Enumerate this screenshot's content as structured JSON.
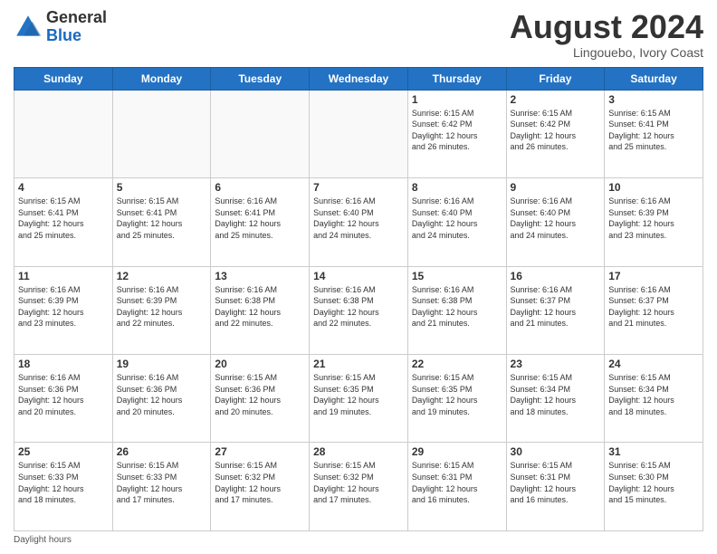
{
  "header": {
    "logo_general": "General",
    "logo_blue": "Blue",
    "month": "August 2024",
    "location": "Lingouebo, Ivory Coast"
  },
  "weekdays": [
    "Sunday",
    "Monday",
    "Tuesday",
    "Wednesday",
    "Thursday",
    "Friday",
    "Saturday"
  ],
  "weeks": [
    [
      {
        "day": "",
        "info": ""
      },
      {
        "day": "",
        "info": ""
      },
      {
        "day": "",
        "info": ""
      },
      {
        "day": "",
        "info": ""
      },
      {
        "day": "1",
        "info": "Sunrise: 6:15 AM\nSunset: 6:42 PM\nDaylight: 12 hours\nand 26 minutes."
      },
      {
        "day": "2",
        "info": "Sunrise: 6:15 AM\nSunset: 6:42 PM\nDaylight: 12 hours\nand 26 minutes."
      },
      {
        "day": "3",
        "info": "Sunrise: 6:15 AM\nSunset: 6:41 PM\nDaylight: 12 hours\nand 25 minutes."
      }
    ],
    [
      {
        "day": "4",
        "info": "Sunrise: 6:15 AM\nSunset: 6:41 PM\nDaylight: 12 hours\nand 25 minutes."
      },
      {
        "day": "5",
        "info": "Sunrise: 6:15 AM\nSunset: 6:41 PM\nDaylight: 12 hours\nand 25 minutes."
      },
      {
        "day": "6",
        "info": "Sunrise: 6:16 AM\nSunset: 6:41 PM\nDaylight: 12 hours\nand 25 minutes."
      },
      {
        "day": "7",
        "info": "Sunrise: 6:16 AM\nSunset: 6:40 PM\nDaylight: 12 hours\nand 24 minutes."
      },
      {
        "day": "8",
        "info": "Sunrise: 6:16 AM\nSunset: 6:40 PM\nDaylight: 12 hours\nand 24 minutes."
      },
      {
        "day": "9",
        "info": "Sunrise: 6:16 AM\nSunset: 6:40 PM\nDaylight: 12 hours\nand 24 minutes."
      },
      {
        "day": "10",
        "info": "Sunrise: 6:16 AM\nSunset: 6:39 PM\nDaylight: 12 hours\nand 23 minutes."
      }
    ],
    [
      {
        "day": "11",
        "info": "Sunrise: 6:16 AM\nSunset: 6:39 PM\nDaylight: 12 hours\nand 23 minutes."
      },
      {
        "day": "12",
        "info": "Sunrise: 6:16 AM\nSunset: 6:39 PM\nDaylight: 12 hours\nand 22 minutes."
      },
      {
        "day": "13",
        "info": "Sunrise: 6:16 AM\nSunset: 6:38 PM\nDaylight: 12 hours\nand 22 minutes."
      },
      {
        "day": "14",
        "info": "Sunrise: 6:16 AM\nSunset: 6:38 PM\nDaylight: 12 hours\nand 22 minutes."
      },
      {
        "day": "15",
        "info": "Sunrise: 6:16 AM\nSunset: 6:38 PM\nDaylight: 12 hours\nand 21 minutes."
      },
      {
        "day": "16",
        "info": "Sunrise: 6:16 AM\nSunset: 6:37 PM\nDaylight: 12 hours\nand 21 minutes."
      },
      {
        "day": "17",
        "info": "Sunrise: 6:16 AM\nSunset: 6:37 PM\nDaylight: 12 hours\nand 21 minutes."
      }
    ],
    [
      {
        "day": "18",
        "info": "Sunrise: 6:16 AM\nSunset: 6:36 PM\nDaylight: 12 hours\nand 20 minutes."
      },
      {
        "day": "19",
        "info": "Sunrise: 6:16 AM\nSunset: 6:36 PM\nDaylight: 12 hours\nand 20 minutes."
      },
      {
        "day": "20",
        "info": "Sunrise: 6:15 AM\nSunset: 6:36 PM\nDaylight: 12 hours\nand 20 minutes."
      },
      {
        "day": "21",
        "info": "Sunrise: 6:15 AM\nSunset: 6:35 PM\nDaylight: 12 hours\nand 19 minutes."
      },
      {
        "day": "22",
        "info": "Sunrise: 6:15 AM\nSunset: 6:35 PM\nDaylight: 12 hours\nand 19 minutes."
      },
      {
        "day": "23",
        "info": "Sunrise: 6:15 AM\nSunset: 6:34 PM\nDaylight: 12 hours\nand 18 minutes."
      },
      {
        "day": "24",
        "info": "Sunrise: 6:15 AM\nSunset: 6:34 PM\nDaylight: 12 hours\nand 18 minutes."
      }
    ],
    [
      {
        "day": "25",
        "info": "Sunrise: 6:15 AM\nSunset: 6:33 PM\nDaylight: 12 hours\nand 18 minutes."
      },
      {
        "day": "26",
        "info": "Sunrise: 6:15 AM\nSunset: 6:33 PM\nDaylight: 12 hours\nand 17 minutes."
      },
      {
        "day": "27",
        "info": "Sunrise: 6:15 AM\nSunset: 6:32 PM\nDaylight: 12 hours\nand 17 minutes."
      },
      {
        "day": "28",
        "info": "Sunrise: 6:15 AM\nSunset: 6:32 PM\nDaylight: 12 hours\nand 17 minutes."
      },
      {
        "day": "29",
        "info": "Sunrise: 6:15 AM\nSunset: 6:31 PM\nDaylight: 12 hours\nand 16 minutes."
      },
      {
        "day": "30",
        "info": "Sunrise: 6:15 AM\nSunset: 6:31 PM\nDaylight: 12 hours\nand 16 minutes."
      },
      {
        "day": "31",
        "info": "Sunrise: 6:15 AM\nSunset: 6:30 PM\nDaylight: 12 hours\nand 15 minutes."
      }
    ]
  ],
  "footer": "Daylight hours"
}
